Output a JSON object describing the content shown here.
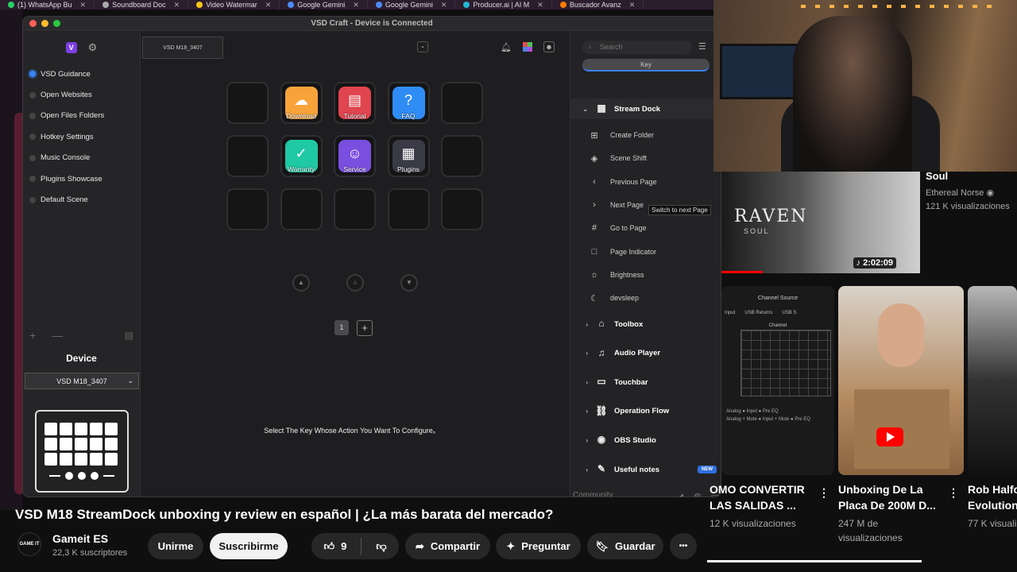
{
  "browser_tabs": [
    {
      "label": "(1) WhatsApp Bu",
      "color": "#25d366"
    },
    {
      "label": "Soundboard Doc",
      "color": "#aaaaaa"
    },
    {
      "label": "Video Watermar",
      "color": "#f5c518"
    },
    {
      "label": "Google Gemini",
      "color": "#4c8bf5"
    },
    {
      "label": "Google Gemini",
      "color": "#4c8bf5"
    },
    {
      "label": "Producer.ai | AI M",
      "color": "#22b7d4"
    },
    {
      "label": "Buscador Avanz",
      "color": "#ff7a00"
    }
  ],
  "app": {
    "title": "VSD Craft - Device is Connected",
    "device_tab": "VSD M18_3407",
    "scenes": [
      {
        "label": "VSD Guidance",
        "active": true
      },
      {
        "label": "Open Websites",
        "active": false
      },
      {
        "label": "Open Files Folders",
        "active": false
      },
      {
        "label": "Hotkey Settings",
        "active": false
      },
      {
        "label": "Music Console",
        "active": false
      },
      {
        "label": "Plugins Showcase",
        "active": false
      },
      {
        "label": "Default Scene",
        "active": false
      }
    ],
    "add_symbol": "+",
    "remove_symbol": "—",
    "device_label": "Device",
    "device_select": "VSD M18_3407",
    "keys": [
      {
        "label": "",
        "glyph": "",
        "color": ""
      },
      {
        "label": "Download",
        "glyph": "☁",
        "color": "#f7a33a"
      },
      {
        "label": "Tutorial",
        "glyph": "▤",
        "color": "#e0454f"
      },
      {
        "label": "FAQ",
        "glyph": "?",
        "color": "#2f8cf5"
      },
      {
        "label": "",
        "glyph": "",
        "color": ""
      },
      {
        "label": "",
        "glyph": "",
        "color": ""
      },
      {
        "label": "Warranty",
        "glyph": "✓",
        "color": "#1fc9a4"
      },
      {
        "label": "Service",
        "glyph": "☺",
        "color": "#7a4fe0"
      },
      {
        "label": "Plugins",
        "glyph": "▦",
        "color": "#3a3a46"
      },
      {
        "label": "",
        "glyph": "",
        "color": ""
      },
      {
        "label": "",
        "glyph": "",
        "color": ""
      },
      {
        "label": "",
        "glyph": "",
        "color": ""
      },
      {
        "label": "",
        "glyph": "",
        "color": ""
      },
      {
        "label": "",
        "glyph": "",
        "color": ""
      },
      {
        "label": "",
        "glyph": "",
        "color": ""
      }
    ],
    "page_number": "1",
    "page_add": "+",
    "hint": "Select The Key Whose Action You Want To Configure。",
    "search_placeholder": "Search",
    "key_tab": "Key",
    "categories_open": {
      "label": "Stream Dock",
      "icon": "▦"
    },
    "actions": [
      {
        "label": "Create Folder",
        "icon": "⊞"
      },
      {
        "label": "Scene Shift",
        "icon": "◈"
      },
      {
        "label": "Previous Page",
        "icon": "‹"
      },
      {
        "label": "Next Page",
        "icon": "›"
      },
      {
        "label": "Go to Page",
        "icon": "#"
      },
      {
        "label": "Page Indicator",
        "icon": "□"
      },
      {
        "label": "Brightness",
        "icon": "☼"
      },
      {
        "label": "devsleep",
        "icon": "☾"
      }
    ],
    "tooltip": "Switch to next Page",
    "categories": [
      {
        "label": "Toolbox",
        "icon": "⌂"
      },
      {
        "label": "Audio Player",
        "icon": "♫"
      },
      {
        "label": "Touchbar",
        "icon": "▭"
      },
      {
        "label": "Operation Flow",
        "icon": "⛓"
      },
      {
        "label": "OBS Studio",
        "icon": "◉"
      },
      {
        "label": "Useful notes",
        "icon": "✎",
        "badge": "NEW"
      }
    ],
    "community": "Community",
    "accent": "#3b82f6"
  },
  "youtube": {
    "featured": {
      "title": "Soul",
      "channel": "Ethereal Norse",
      "views": "121 K visualizaciones",
      "duration": "2:02:09",
      "thumb_word": "RAVEN",
      "thumb_sub": "SOUL"
    },
    "thumb1": {
      "header": "Channel Source",
      "row1": "Input",
      "row2": "USB Returns",
      "row3": "USB S",
      "channel": "Channel",
      "legend1": "Analog  ● Input   ● Pre EQ",
      "legend2": "Analog + Mute  ● Input + Mute  ● Pre EQ"
    },
    "cards": [
      {
        "title1": "OMO CONVERTIR",
        "title2": "LAS SALIDAS ...",
        "meta1": "12 K visualizaciones",
        "meta2": ""
      },
      {
        "title1": "Unboxing De La",
        "title2": "Placa De 200M D...",
        "meta1": "247 M de",
        "meta2": "visualizaciones"
      },
      {
        "title1": "Rob Halfo",
        "title2": "Evolution",
        "meta1": "77 K visuali",
        "meta2": ""
      }
    ],
    "video_title": "VSD M18 StreamDock unboxing y review en español | ¿La más barata del mercado?",
    "channel_avatar": "GAME IT",
    "channel_name": "Gameit ES",
    "subscribers": "22,3 K suscriptores",
    "join": "Unirme",
    "subscribe": "Suscribirme",
    "likes": "9",
    "share": "Compartir",
    "ask": "Preguntar",
    "save": "Guardar",
    "more": "•••"
  }
}
